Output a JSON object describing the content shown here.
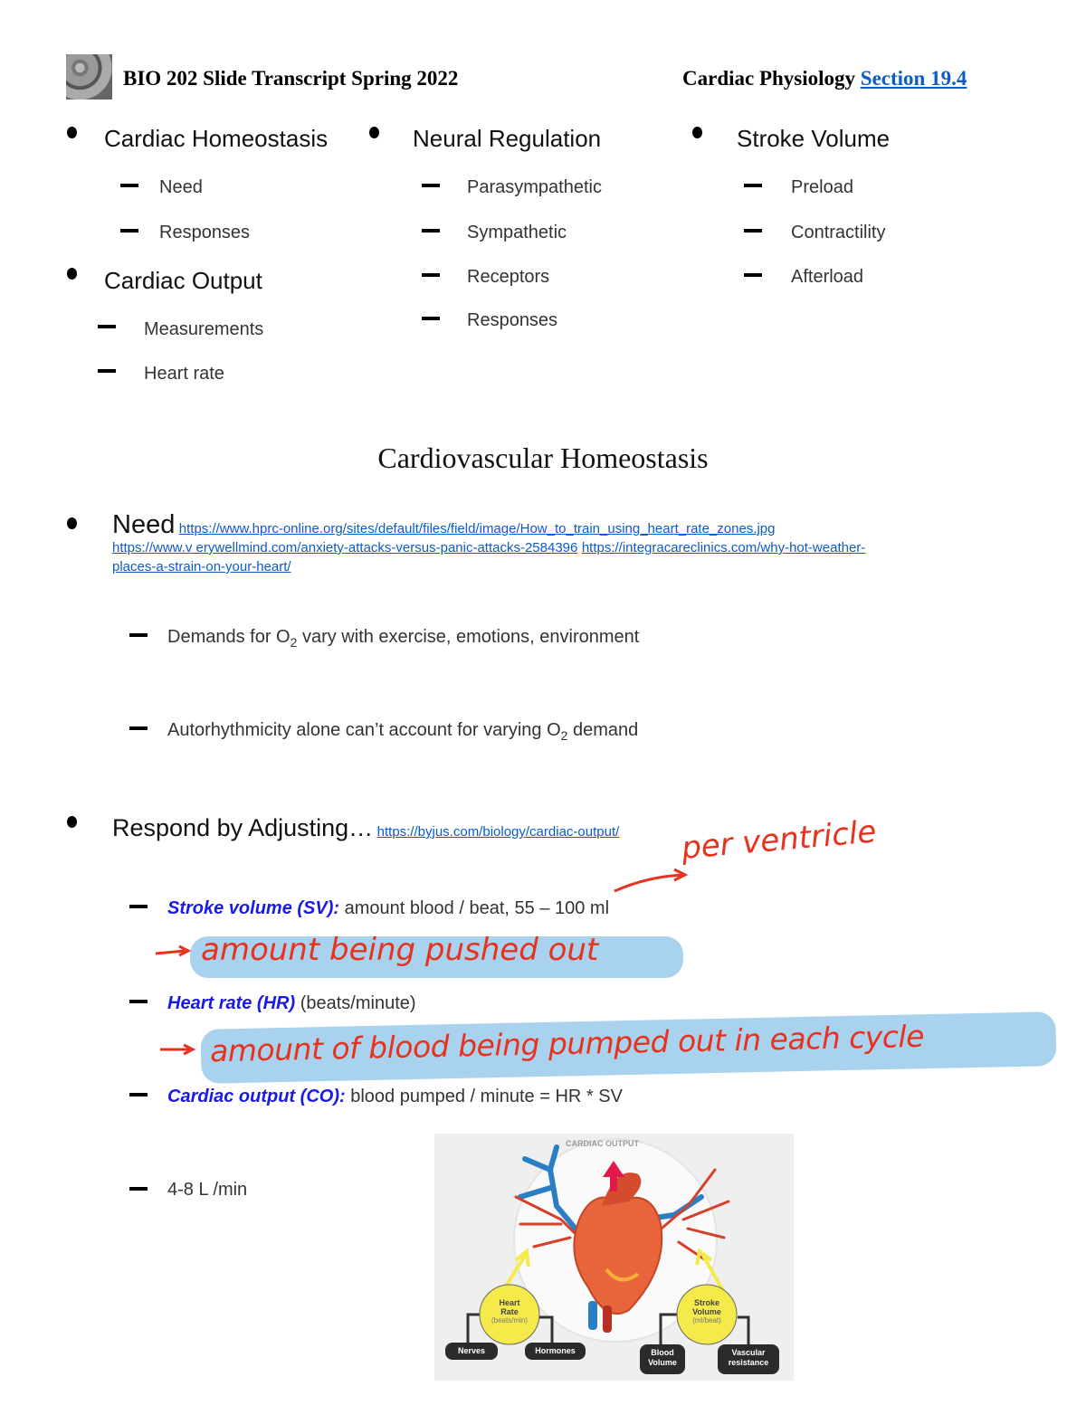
{
  "header": {
    "title": "BIO 202 Slide Transcript Spring 2022",
    "topic": "Cardiac Physiology",
    "section_link": "Section 19.4",
    "logo_icon": "cell-microscopy-thumbnail"
  },
  "outline": {
    "col1": [
      {
        "heading": "Cardiac Homeostasis",
        "items": [
          "Need",
          "Responses"
        ]
      },
      {
        "heading": "Cardiac Output",
        "items": [
          "Measurements",
          "Heart rate"
        ]
      }
    ],
    "col2": [
      {
        "heading": "Neural Regulation",
        "items": [
          "Parasympathetic",
          "Sympathetic",
          "Receptors",
          "Responses"
        ]
      }
    ],
    "col3": [
      {
        "heading": "Stroke Volume",
        "items": [
          "Preload",
          "Contractility",
          "Afterload"
        ]
      }
    ]
  },
  "section_title": "Cardiovascular Homeostasis",
  "need": {
    "label": "Need",
    "links": [
      "https://www.hprc-online.org/sites/default/files/field/image/How_to_train_using_heart_rate_zones.jpg",
      "https://www.verywellmind.com/anxiety-attacks-versus-panic-attacks-2584396",
      "https://integracareclinics.com/why-hot-weather-places-a-strain-on-your-heart/"
    ],
    "link_lines": [
      "https://www.hprc-online.org/sites/default/files/field/image/How_to_train_using_heart_rate_zones.jpg",
      "https://www.v erywellmind.com/anxiety-attacks-versus-panic-attacks-2584396",
      "https://integracareclinics.com/why-hot-weather-",
      "places-a-strain-on-your-heart/"
    ],
    "points": [
      {
        "pre": "Demands for O",
        "sub": "2",
        "post": " vary with exercise, emotions, environment"
      },
      {
        "pre": "Autorhythmicity alone can’t account for varying O",
        "sub": "2",
        "post": " demand"
      }
    ]
  },
  "respond": {
    "label": "Respond by Adjusting…",
    "link": "https://byjus.com/biology/cardiac-output/",
    "items": [
      {
        "term": "Stroke volume (SV):",
        "text": " amount blood / beat, 55 – 100 ml"
      },
      {
        "term": "Heart rate (HR)",
        "text": " (beats/minute)"
      },
      {
        "term": "Cardiac output (CO):",
        "text": " blood pumped / minute = HR * SV"
      },
      {
        "term": "",
        "text": "4-8 L /min"
      }
    ]
  },
  "annotations": {
    "per_ventricle": "per ventricle",
    "sv_note": "amount being pushed out",
    "hr_note": "amount of blood being pumped out in each cycle"
  },
  "diagram": {
    "title": "CARDIAC OUTPUT",
    "left_circle": {
      "title1": "Heart",
      "title2": "Rate",
      "unit": "(beats/min)"
    },
    "right_circle": {
      "title1": "Stroke",
      "title2": "Volume",
      "unit": "(ml/beat)"
    },
    "left_boxes": [
      "Nerves",
      "Hormones"
    ],
    "right_boxes": [
      [
        "Blood",
        "Volume"
      ],
      [
        "Vascular",
        "resistance"
      ]
    ],
    "colors": {
      "circle": "#f4ea4a",
      "box": "#2b2b2b",
      "arrow_up": "#e0194a",
      "artery": "#d5402c",
      "vein": "#2a7fc4"
    }
  }
}
